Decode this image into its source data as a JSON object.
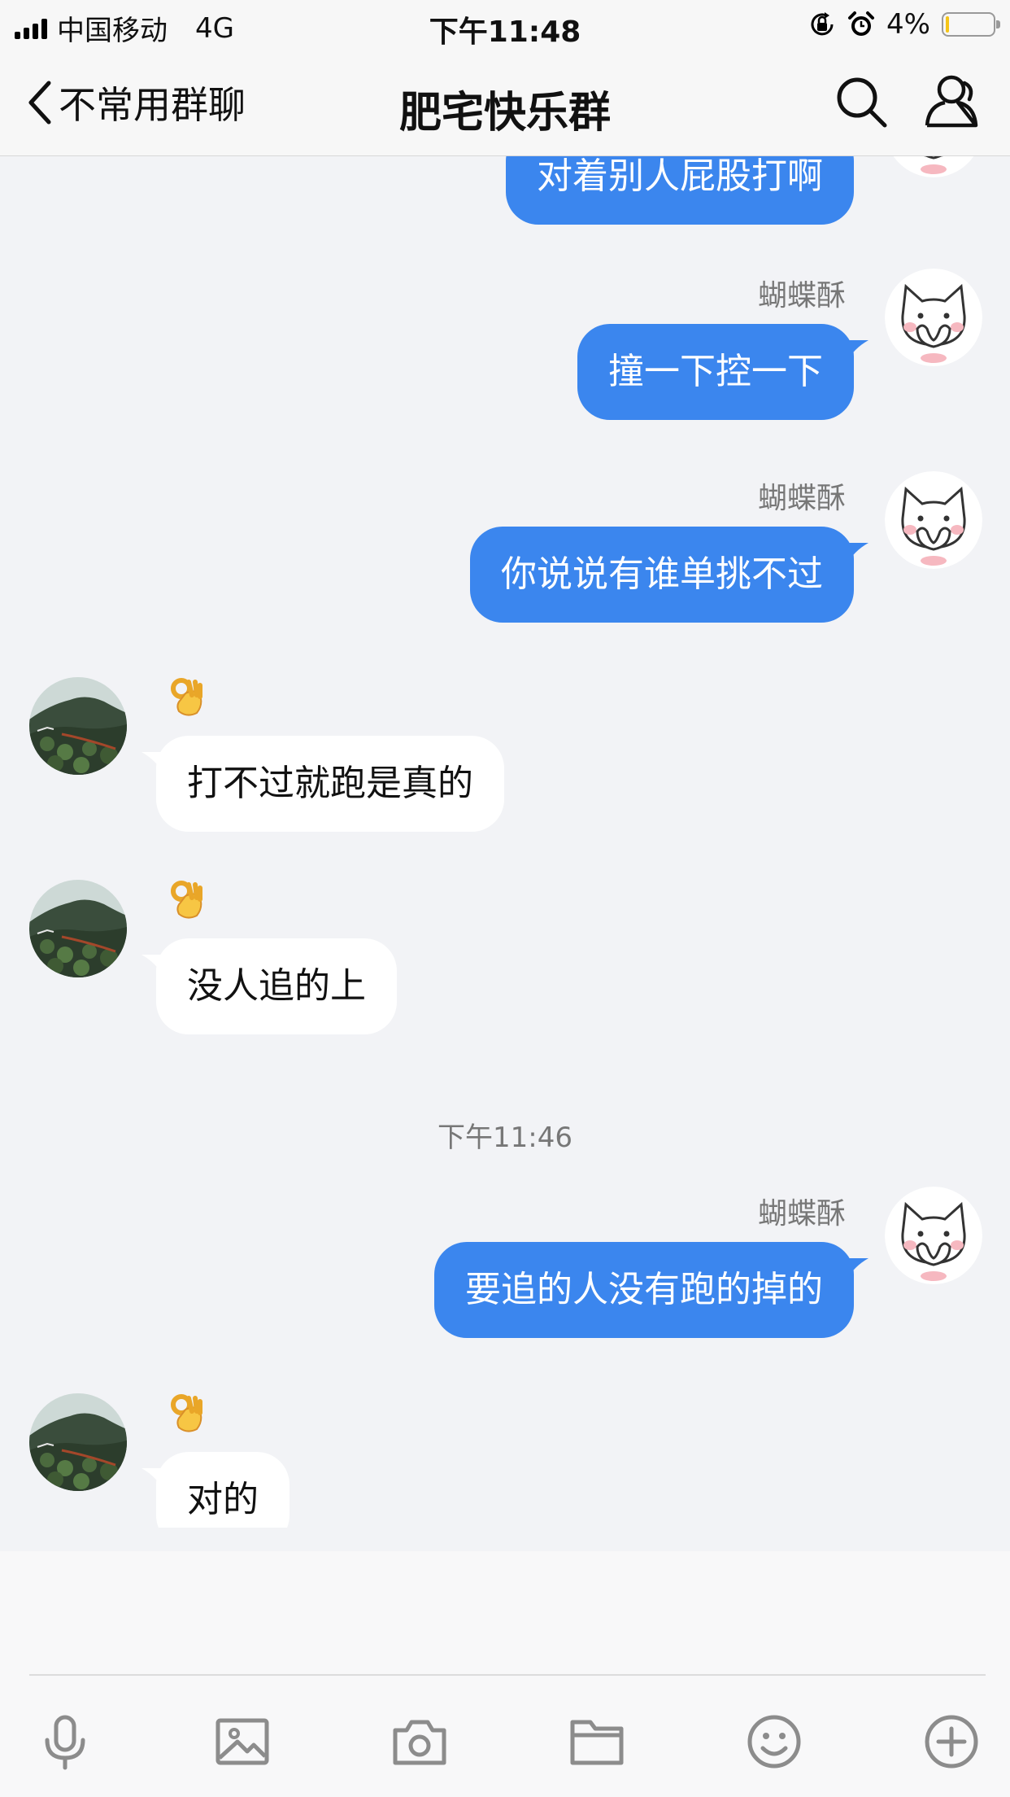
{
  "status_bar": {
    "carrier": "中国移动",
    "network": "4G",
    "time": "下午11:48",
    "battery_percent": "4%",
    "battery_level": 0.04
  },
  "nav": {
    "back_label": "不常用群聊",
    "title": "肥宅快乐群",
    "search_icon": "search-icon",
    "group_icon": "group-members-icon"
  },
  "messages": [
    {
      "side": "right",
      "text": "对着别人屁股打啊"
    },
    {
      "side": "right",
      "sender": "蝴蝶酥",
      "text": "撞一下控一下"
    },
    {
      "side": "right",
      "sender": "蝴蝶酥",
      "text": "你说说有谁单挑不过"
    },
    {
      "side": "left",
      "badge": "ok-hand-emoji",
      "text": "打不过就跑是真的"
    },
    {
      "side": "left",
      "badge": "ok-hand-emoji",
      "text": "没人追的上"
    },
    {
      "side": "right",
      "sender": "蝴蝶酥",
      "text": "要追的人没有跑的掉的"
    },
    {
      "side": "left",
      "badge": "ok-hand-emoji",
      "text": "对的"
    }
  ],
  "timestamp": "下午11:46",
  "toolbar": [
    "microphone-icon",
    "image-icon",
    "camera-icon",
    "folder-icon",
    "emoji-icon",
    "plus-icon"
  ],
  "colors": {
    "outgoing_bubble": "#3b86ee",
    "incoming_bubble": "#ffffff",
    "chat_background": "#f2f3f6",
    "battery_fill": "#f5c518"
  }
}
